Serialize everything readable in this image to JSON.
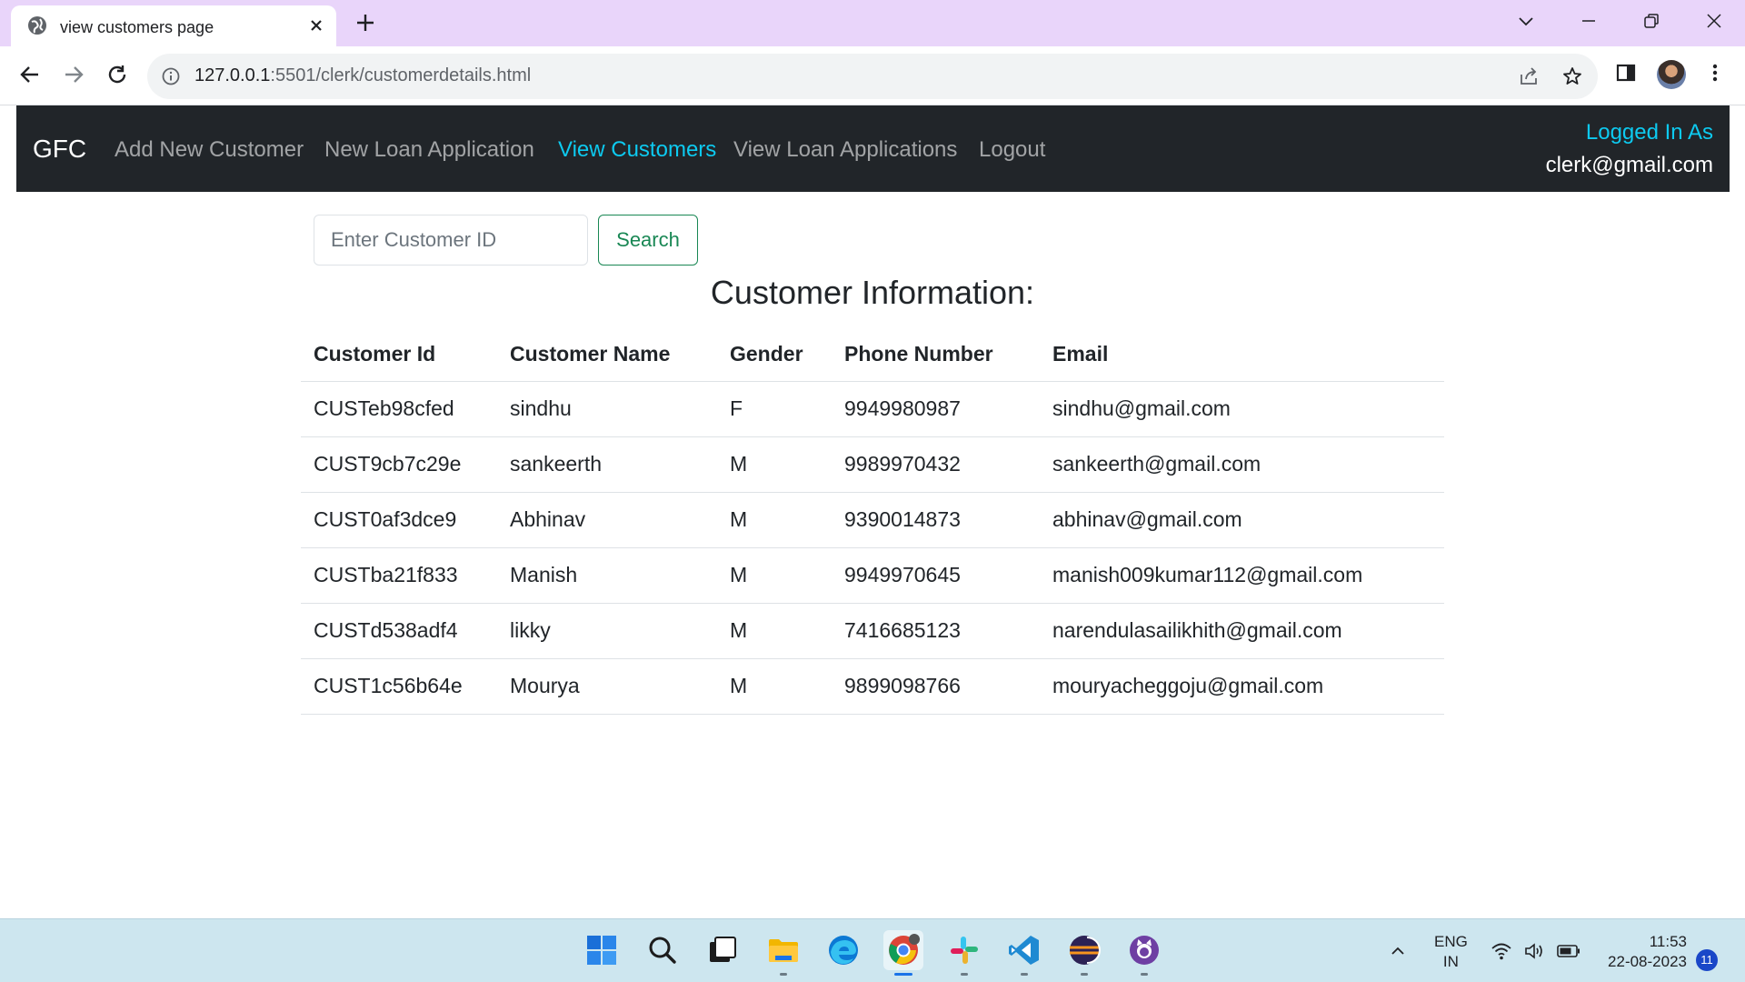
{
  "browser": {
    "tab_title": "view customers page",
    "url_host": "127.0.0.1",
    "url_path": ":5501/clerk/customerdetails.html"
  },
  "navbar": {
    "brand": "GFC",
    "links": [
      {
        "label": "Add New Customer",
        "active": false
      },
      {
        "label": "New Loan Application",
        "active": false
      },
      {
        "label": "View Customers",
        "active": true
      },
      {
        "label": "View Loan Applications",
        "active": false
      },
      {
        "label": "Logout",
        "active": false
      }
    ],
    "logged_in_label": "Logged In As",
    "logged_in_user": "clerk@gmail.com"
  },
  "search": {
    "placeholder": "Enter Customer ID",
    "button_label": "Search"
  },
  "section_title": "Customer Information:",
  "table": {
    "headers": [
      "Customer Id",
      "Customer Name",
      "Gender",
      "Phone Number",
      "Email"
    ],
    "rows": [
      [
        "CUSTeb98cfed",
        "sindhu",
        "F",
        "9949980987",
        "sindhu@gmail.com"
      ],
      [
        "CUST9cb7c29e",
        "sankeerth",
        "M",
        "9989970432",
        "sankeerth@gmail.com"
      ],
      [
        "CUST0af3dce9",
        "Abhinav",
        "M",
        "9390014873",
        "abhinav@gmail.com"
      ],
      [
        "CUSTba21f833",
        "Manish",
        "M",
        "9949970645",
        "manish009kumar112@gmail.com"
      ],
      [
        "CUSTd538adf4",
        "likky",
        "M",
        "7416685123",
        "narendulasailikhith@gmail.com"
      ],
      [
        "CUST1c56b64e",
        "Mourya",
        "M",
        "9899098766",
        "mouryacheggoju@gmail.com"
      ]
    ]
  },
  "taskbar": {
    "apps": [
      "windows-start",
      "search",
      "task-view",
      "file-explorer",
      "edge",
      "chrome",
      "slack",
      "vscode",
      "eclipse",
      "github-desktop"
    ],
    "active_app": "chrome",
    "language_line1": "ENG",
    "language_line2": "IN",
    "time": "11:53",
    "date": "22-08-2023",
    "notification_count": "11"
  },
  "colors": {
    "navbar_bg": "#212529",
    "active_link": "#0dcaf0",
    "search_button": "#198754",
    "tab_strip": "#e9d5fa",
    "taskbar_bg": "#cde6ef"
  }
}
